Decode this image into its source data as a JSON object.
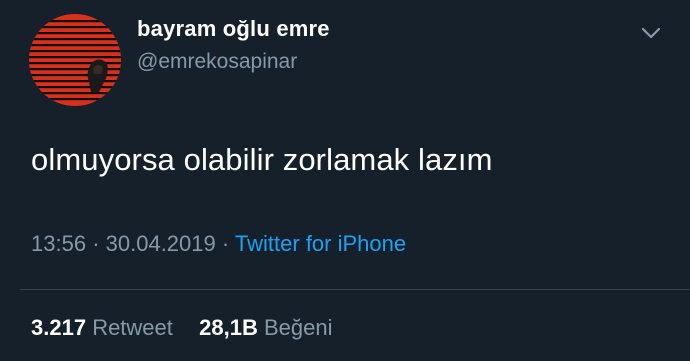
{
  "user": {
    "display_name": "bayram oğlu emre",
    "handle": "@emrekosapinar",
    "avatar_icon": "red-striped-circle-avatar"
  },
  "menu": {
    "icon": "chevron-down-icon"
  },
  "tweet": {
    "text": "olmuyorsa olabilir zorlamak lazım",
    "time": "13:56",
    "date": "30.04.2019",
    "separator": "·",
    "source": "Twitter for iPhone"
  },
  "stats": {
    "retweet_count": "3.217",
    "retweet_label": "Retweet",
    "like_count": "28,1B",
    "like_label": "Beğeni"
  },
  "colors": {
    "background": "#15202b",
    "text": "#ffffff",
    "secondary": "#8899a6",
    "link": "#1da1f2",
    "avatar": "#d9301a"
  }
}
